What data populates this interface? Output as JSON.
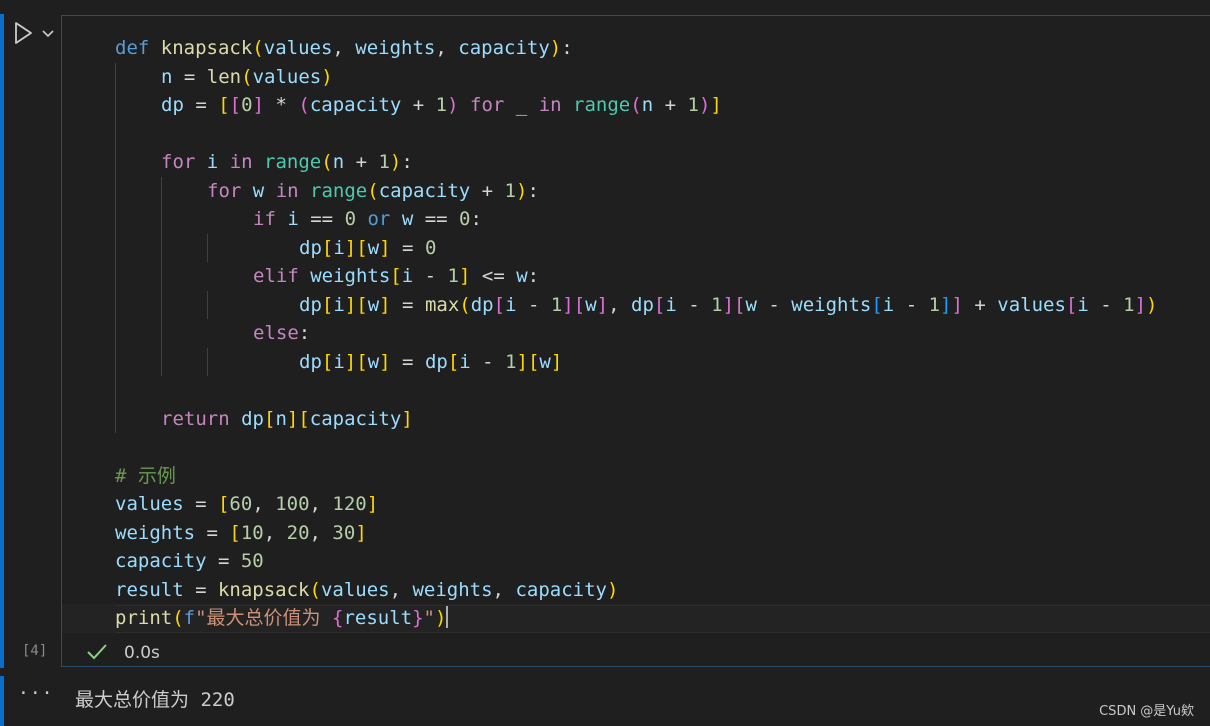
{
  "cell": {
    "execution_count": "[4]",
    "status_time": "0.0s",
    "run_icon": "play-icon",
    "menu_icon": "chevron-down-icon",
    "status_icon": "checkmark-icon",
    "code_lines": [
      {
        "indent": 0,
        "tokens": [
          [
            "kw",
            "def"
          ],
          [
            "pl",
            " "
          ],
          [
            "fn",
            "knapsack"
          ],
          [
            "b1",
            "("
          ],
          [
            "var",
            "values"
          ],
          [
            "pl",
            ", "
          ],
          [
            "var",
            "weights"
          ],
          [
            "pl",
            ", "
          ],
          [
            "var",
            "capacity"
          ],
          [
            "b1",
            ")"
          ],
          [
            "pl",
            ":"
          ]
        ]
      },
      {
        "indent": 1,
        "tokens": [
          [
            "var",
            "n"
          ],
          [
            "pl",
            " = "
          ],
          [
            "fn",
            "len"
          ],
          [
            "b1",
            "("
          ],
          [
            "var",
            "values"
          ],
          [
            "b1",
            ")"
          ]
        ]
      },
      {
        "indent": 1,
        "tokens": [
          [
            "var",
            "dp"
          ],
          [
            "pl",
            " = "
          ],
          [
            "b1",
            "["
          ],
          [
            "b2",
            "["
          ],
          [
            "num",
            "0"
          ],
          [
            "b2",
            "]"
          ],
          [
            "pl",
            " * "
          ],
          [
            "b2",
            "("
          ],
          [
            "var",
            "capacity"
          ],
          [
            "pl",
            " + "
          ],
          [
            "num",
            "1"
          ],
          [
            "b2",
            ")"
          ],
          [
            "pl",
            " "
          ],
          [
            "ctl",
            "for"
          ],
          [
            "pl",
            " "
          ],
          [
            "var",
            "_"
          ],
          [
            "pl",
            " "
          ],
          [
            "ctl",
            "in"
          ],
          [
            "pl",
            " "
          ],
          [
            "cls",
            "range"
          ],
          [
            "b2",
            "("
          ],
          [
            "var",
            "n"
          ],
          [
            "pl",
            " + "
          ],
          [
            "num",
            "1"
          ],
          [
            "b2",
            ")"
          ],
          [
            "b1",
            "]"
          ]
        ]
      },
      {
        "indent": 1,
        "tokens": []
      },
      {
        "indent": 1,
        "tokens": [
          [
            "ctl",
            "for"
          ],
          [
            "pl",
            " "
          ],
          [
            "var",
            "i"
          ],
          [
            "pl",
            " "
          ],
          [
            "ctl",
            "in"
          ],
          [
            "pl",
            " "
          ],
          [
            "cls",
            "range"
          ],
          [
            "b1",
            "("
          ],
          [
            "var",
            "n"
          ],
          [
            "pl",
            " + "
          ],
          [
            "num",
            "1"
          ],
          [
            "b1",
            ")"
          ],
          [
            "pl",
            ":"
          ]
        ]
      },
      {
        "indent": 2,
        "tokens": [
          [
            "ctl",
            "for"
          ],
          [
            "pl",
            " "
          ],
          [
            "var",
            "w"
          ],
          [
            "pl",
            " "
          ],
          [
            "ctl",
            "in"
          ],
          [
            "pl",
            " "
          ],
          [
            "cls",
            "range"
          ],
          [
            "b1",
            "("
          ],
          [
            "var",
            "capacity"
          ],
          [
            "pl",
            " + "
          ],
          [
            "num",
            "1"
          ],
          [
            "b1",
            ")"
          ],
          [
            "pl",
            ":"
          ]
        ]
      },
      {
        "indent": 3,
        "tokens": [
          [
            "ctl",
            "if"
          ],
          [
            "pl",
            " "
          ],
          [
            "var",
            "i"
          ],
          [
            "pl",
            " == "
          ],
          [
            "num",
            "0"
          ],
          [
            "pl",
            " "
          ],
          [
            "kw",
            "or"
          ],
          [
            "pl",
            " "
          ],
          [
            "var",
            "w"
          ],
          [
            "pl",
            " == "
          ],
          [
            "num",
            "0"
          ],
          [
            "pl",
            ":"
          ]
        ]
      },
      {
        "indent": 4,
        "tokens": [
          [
            "var",
            "dp"
          ],
          [
            "b1",
            "["
          ],
          [
            "var",
            "i"
          ],
          [
            "b1",
            "]"
          ],
          [
            "b1",
            "["
          ],
          [
            "var",
            "w"
          ],
          [
            "b1",
            "]"
          ],
          [
            "pl",
            " = "
          ],
          [
            "num",
            "0"
          ]
        ]
      },
      {
        "indent": 3,
        "tokens": [
          [
            "ctl",
            "elif"
          ],
          [
            "pl",
            " "
          ],
          [
            "var",
            "weights"
          ],
          [
            "b1",
            "["
          ],
          [
            "var",
            "i"
          ],
          [
            "pl",
            " - "
          ],
          [
            "num",
            "1"
          ],
          [
            "b1",
            "]"
          ],
          [
            "pl",
            " <= "
          ],
          [
            "var",
            "w"
          ],
          [
            "pl",
            ":"
          ]
        ]
      },
      {
        "indent": 4,
        "tokens": [
          [
            "var",
            "dp"
          ],
          [
            "b1",
            "["
          ],
          [
            "var",
            "i"
          ],
          [
            "b1",
            "]"
          ],
          [
            "b1",
            "["
          ],
          [
            "var",
            "w"
          ],
          [
            "b1",
            "]"
          ],
          [
            "pl",
            " = "
          ],
          [
            "fn",
            "max"
          ],
          [
            "b1",
            "("
          ],
          [
            "var",
            "dp"
          ],
          [
            "b2",
            "["
          ],
          [
            "var",
            "i"
          ],
          [
            "pl",
            " - "
          ],
          [
            "num",
            "1"
          ],
          [
            "b2",
            "]"
          ],
          [
            "b2",
            "["
          ],
          [
            "var",
            "w"
          ],
          [
            "b2",
            "]"
          ],
          [
            "pl",
            ", "
          ],
          [
            "var",
            "dp"
          ],
          [
            "b2",
            "["
          ],
          [
            "var",
            "i"
          ],
          [
            "pl",
            " - "
          ],
          [
            "num",
            "1"
          ],
          [
            "b2",
            "]"
          ],
          [
            "b2",
            "["
          ],
          [
            "var",
            "w"
          ],
          [
            "pl",
            " - "
          ],
          [
            "var",
            "weights"
          ],
          [
            "b3",
            "["
          ],
          [
            "var",
            "i"
          ],
          [
            "pl",
            " - "
          ],
          [
            "num",
            "1"
          ],
          [
            "b3",
            "]"
          ],
          [
            "b2",
            "]"
          ],
          [
            "pl",
            " + "
          ],
          [
            "var",
            "values"
          ],
          [
            "b2",
            "["
          ],
          [
            "var",
            "i"
          ],
          [
            "pl",
            " - "
          ],
          [
            "num",
            "1"
          ],
          [
            "b2",
            "]"
          ],
          [
            "b1",
            ")"
          ]
        ]
      },
      {
        "indent": 3,
        "tokens": [
          [
            "ctl",
            "else"
          ],
          [
            "pl",
            ":"
          ]
        ]
      },
      {
        "indent": 4,
        "tokens": [
          [
            "var",
            "dp"
          ],
          [
            "b1",
            "["
          ],
          [
            "var",
            "i"
          ],
          [
            "b1",
            "]"
          ],
          [
            "b1",
            "["
          ],
          [
            "var",
            "w"
          ],
          [
            "b1",
            "]"
          ],
          [
            "pl",
            " = "
          ],
          [
            "var",
            "dp"
          ],
          [
            "b1",
            "["
          ],
          [
            "var",
            "i"
          ],
          [
            "pl",
            " - "
          ],
          [
            "num",
            "1"
          ],
          [
            "b1",
            "]"
          ],
          [
            "b1",
            "["
          ],
          [
            "var",
            "w"
          ],
          [
            "b1",
            "]"
          ]
        ]
      },
      {
        "indent": 1,
        "tokens": []
      },
      {
        "indent": 1,
        "tokens": [
          [
            "ctl",
            "return"
          ],
          [
            "pl",
            " "
          ],
          [
            "var",
            "dp"
          ],
          [
            "b1",
            "["
          ],
          [
            "var",
            "n"
          ],
          [
            "b1",
            "]"
          ],
          [
            "b1",
            "["
          ],
          [
            "var",
            "capacity"
          ],
          [
            "b1",
            "]"
          ]
        ]
      },
      {
        "indent": 0,
        "tokens": []
      },
      {
        "indent": 0,
        "tokens": [
          [
            "cmt",
            "# 示例"
          ]
        ]
      },
      {
        "indent": 0,
        "tokens": [
          [
            "var",
            "values"
          ],
          [
            "pl",
            " = "
          ],
          [
            "b1",
            "["
          ],
          [
            "num",
            "60"
          ],
          [
            "pl",
            ", "
          ],
          [
            "num",
            "100"
          ],
          [
            "pl",
            ", "
          ],
          [
            "num",
            "120"
          ],
          [
            "b1",
            "]"
          ]
        ]
      },
      {
        "indent": 0,
        "tokens": [
          [
            "var",
            "weights"
          ],
          [
            "pl",
            " = "
          ],
          [
            "b1",
            "["
          ],
          [
            "num",
            "10"
          ],
          [
            "pl",
            ", "
          ],
          [
            "num",
            "20"
          ],
          [
            "pl",
            ", "
          ],
          [
            "num",
            "30"
          ],
          [
            "b1",
            "]"
          ]
        ]
      },
      {
        "indent": 0,
        "tokens": [
          [
            "var",
            "capacity"
          ],
          [
            "pl",
            " = "
          ],
          [
            "num",
            "50"
          ]
        ]
      },
      {
        "indent": 0,
        "tokens": [
          [
            "var",
            "result"
          ],
          [
            "pl",
            " = "
          ],
          [
            "fn",
            "knapsack"
          ],
          [
            "b1",
            "("
          ],
          [
            "var",
            "values"
          ],
          [
            "pl",
            ", "
          ],
          [
            "var",
            "weights"
          ],
          [
            "pl",
            ", "
          ],
          [
            "var",
            "capacity"
          ],
          [
            "b1",
            ")"
          ]
        ]
      },
      {
        "indent": 0,
        "active": true,
        "tokens": [
          [
            "fn",
            "print"
          ],
          [
            "b1",
            "("
          ],
          [
            "kw",
            "f"
          ],
          [
            "str",
            "\"最大总价值为 "
          ],
          [
            "b2",
            "{"
          ],
          [
            "var",
            "result"
          ],
          [
            "b2",
            "}"
          ],
          [
            "str",
            "\""
          ],
          [
            "b1",
            ")"
          ]
        ]
      }
    ]
  },
  "guides": [
    {
      "level": 1,
      "from": 1,
      "to": 13
    },
    {
      "level": 2,
      "from": 5,
      "to": 11
    },
    {
      "level": 3,
      "from": 7,
      "to": 7
    },
    {
      "level": 3,
      "from": 9,
      "to": 9
    },
    {
      "level": 3,
      "from": 11,
      "to": 11
    }
  ],
  "output": {
    "menu_icon": "ellipsis-icon",
    "ellipsis": "···",
    "text": "最大总价值为 220"
  },
  "watermark": "CSDN @是Yu欸",
  "colors": {
    "kw": "#569cd6",
    "ctl": "#c586c0",
    "fn": "#dcdcaa",
    "var": "#9cdcfe",
    "cls": "#4ec9b0",
    "num": "#b5cea8",
    "str": "#ce9178",
    "cmt": "#6a9955",
    "pl": "#d4d4d4",
    "b1": "#ffd700",
    "b2": "#da70d6",
    "b3": "#179fff",
    "accent": "#0b6ec8",
    "check": "#89d185"
  }
}
